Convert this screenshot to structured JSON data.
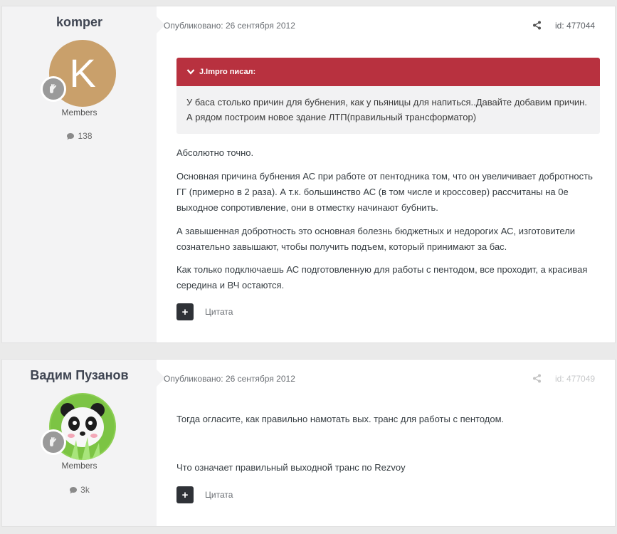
{
  "posts": [
    {
      "author": "komper",
      "avatar_letter": "K",
      "avatar_color": "#c9a06b",
      "group": "Members",
      "post_count": "138",
      "date": "Опубликовано: 26 сентября 2012",
      "post_id": "id: 477044",
      "quote": {
        "header": "J.Impro писал:",
        "text": "У баса столько причин для бубнения, как у пьяницы для напиться..Давайте добавим причин. А рядом построим новое здание ЛТП(правильный трансформатор)"
      },
      "paragraphs": [
        "Абсолютно точно.",
        "Основная причина бубнения АС при работе от пентодника том, что он увеличивает добротность ГГ (примерно в 2 раза). А т.к. большинство АС (в том числе и кроссовер) рассчитаны на 0е выходное сопротивление, они в отместку начинают бубнить.",
        "А завышенная добротность это основная болезнь бюджетных и недорогих АС, изготовители сознательно завышают, чтобы получить подъем, который принимают за бас.",
        "Как только подключаешь АС подготовленную для работы с пентодом, все проходит, а красивая середина и ВЧ остаются."
      ],
      "quote_label": "Цитата"
    },
    {
      "author": "Вадим Пузанов",
      "avatar_icon": "panda-avatar",
      "group": "Members",
      "post_count": "3k",
      "date": "Опубликовано: 26 сентября 2012",
      "post_id": "id: 477049",
      "paragraphs": [
        "Тогда огласите, как правильно намотать вых. транс для работы с пентодом.",
        "Что означает правильный выходной транс по Rezvoy"
      ],
      "quote_label": "Цитата"
    }
  ],
  "colors": {
    "quote_header": "#b8313f",
    "author_panel": "#f3f3f4",
    "button": "#2f3237"
  },
  "icons": {
    "share": "share-icon",
    "comment": "comment-icon",
    "rank": "rank-badge-icon",
    "quote_toggle": "chevron-down-icon",
    "plus": "plus-icon"
  }
}
